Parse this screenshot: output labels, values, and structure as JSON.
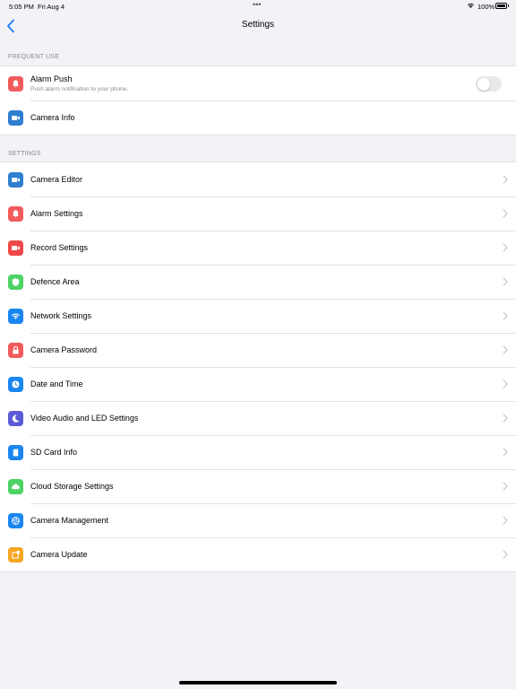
{
  "status_bar": {
    "time": "5:05 PM",
    "date": "Fri Aug 4",
    "dots": "•••",
    "battery": "100%"
  },
  "nav": {
    "title": "Settings",
    "back_icon": "chevron-left-icon"
  },
  "frequent_use": {
    "header": "FREQUENT USE",
    "alarm_push": {
      "label": "Alarm Push",
      "sublabel": "Push alarm notification to your phone.",
      "icon": "bell-icon",
      "color": "#f25b5b",
      "toggle_on": false
    },
    "camera_info": {
      "label": "Camera Info",
      "icon": "video-icon",
      "color": "#2f7fd0"
    }
  },
  "settings": {
    "header": "SETTINGS",
    "items": [
      {
        "label": "Camera Editor",
        "icon": "video-icon",
        "color": "#2f7fd0"
      },
      {
        "label": "Alarm Settings",
        "icon": "bell-icon",
        "color": "#f25b5b"
      },
      {
        "label": "Record Settings",
        "icon": "video-icon",
        "color": "#f04848"
      },
      {
        "label": "Defence Area",
        "icon": "shield-icon",
        "color": "#4cd464"
      },
      {
        "label": "Network Settings",
        "icon": "wifi-icon",
        "color": "#1a86f0"
      },
      {
        "label": "Camera Password",
        "icon": "lock-icon",
        "color": "#f25b5b"
      },
      {
        "label": "Date and Time",
        "icon": "clock-icon",
        "color": "#1a86f0"
      },
      {
        "label": "Video Audio and LED Settings",
        "icon": "moon-icon",
        "color": "#5b5bd6"
      },
      {
        "label": "SD Card Info",
        "icon": "sd-card-icon",
        "color": "#1a86f0"
      },
      {
        "label": "Cloud Storage Settings",
        "icon": "cloud-icon",
        "color": "#4cd464"
      },
      {
        "label": "Camera Management",
        "icon": "aperture-icon",
        "color": "#1a86f0"
      },
      {
        "label": "Camera Update",
        "icon": "update-badge-icon",
        "color": "#f5a623"
      }
    ]
  }
}
